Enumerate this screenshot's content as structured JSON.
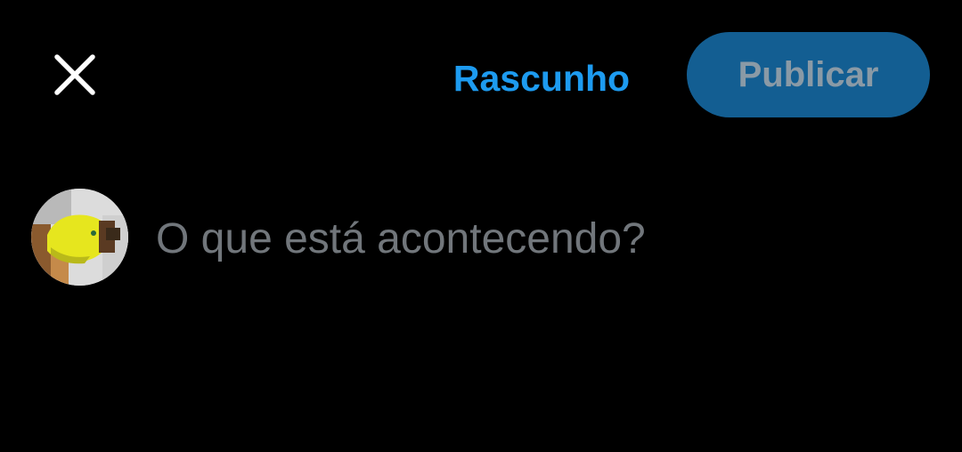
{
  "header": {
    "close_icon": "close-icon",
    "draft_label": "Rascunho",
    "publish_label": "Publicar"
  },
  "composer": {
    "avatar_icon": "user-avatar",
    "placeholder": "O que está acontecendo?",
    "value": ""
  },
  "colors": {
    "background": "#000000",
    "accent": "#1d9bf0",
    "publish_bg": "#135e92",
    "publish_text": "#8a9aa6",
    "placeholder": "#71767b",
    "icon": "#ffffff"
  }
}
